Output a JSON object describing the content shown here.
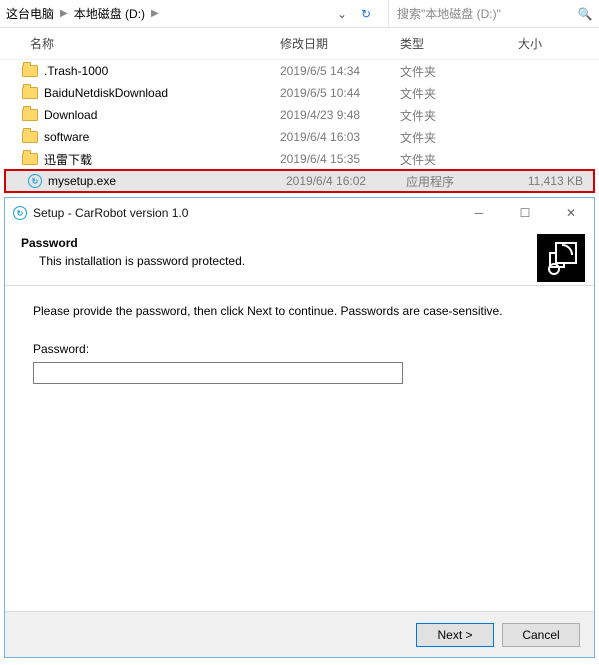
{
  "explorer": {
    "breadcrumb": [
      "这台电脑",
      "本地磁盘 (D:)"
    ],
    "search_placeholder": "搜索\"本地磁盘 (D:)\"",
    "columns": {
      "name": "名称",
      "date": "修改日期",
      "type": "类型",
      "size": "大小"
    },
    "rows": [
      {
        "icon": "folder",
        "name": ".Trash-1000",
        "date": "2019/6/5 14:34",
        "type": "文件夹",
        "size": ""
      },
      {
        "icon": "folder",
        "name": "BaiduNetdiskDownload",
        "date": "2019/6/5 10:44",
        "type": "文件夹",
        "size": ""
      },
      {
        "icon": "folder",
        "name": "Download",
        "date": "2019/4/23 9:48",
        "type": "文件夹",
        "size": ""
      },
      {
        "icon": "folder",
        "name": "software",
        "date": "2019/6/4 16:03",
        "type": "文件夹",
        "size": ""
      },
      {
        "icon": "folder",
        "name": "迅雷下载",
        "date": "2019/6/4 15:35",
        "type": "文件夹",
        "size": ""
      },
      {
        "icon": "exe",
        "name": "mysetup.exe",
        "date": "2019/6/4 16:02",
        "type": "应用程序",
        "size": "11,413 KB",
        "highlighted": true
      }
    ]
  },
  "installer": {
    "title": "Setup - CarRobot version 1.0",
    "header_title": "Password",
    "header_sub": "This installation is password protected.",
    "instruction": "Please provide the password, then click Next to continue. Passwords are case-sensitive.",
    "password_label": "Password:",
    "password_value": "",
    "buttons": {
      "next": "Next >",
      "cancel": "Cancel"
    }
  }
}
